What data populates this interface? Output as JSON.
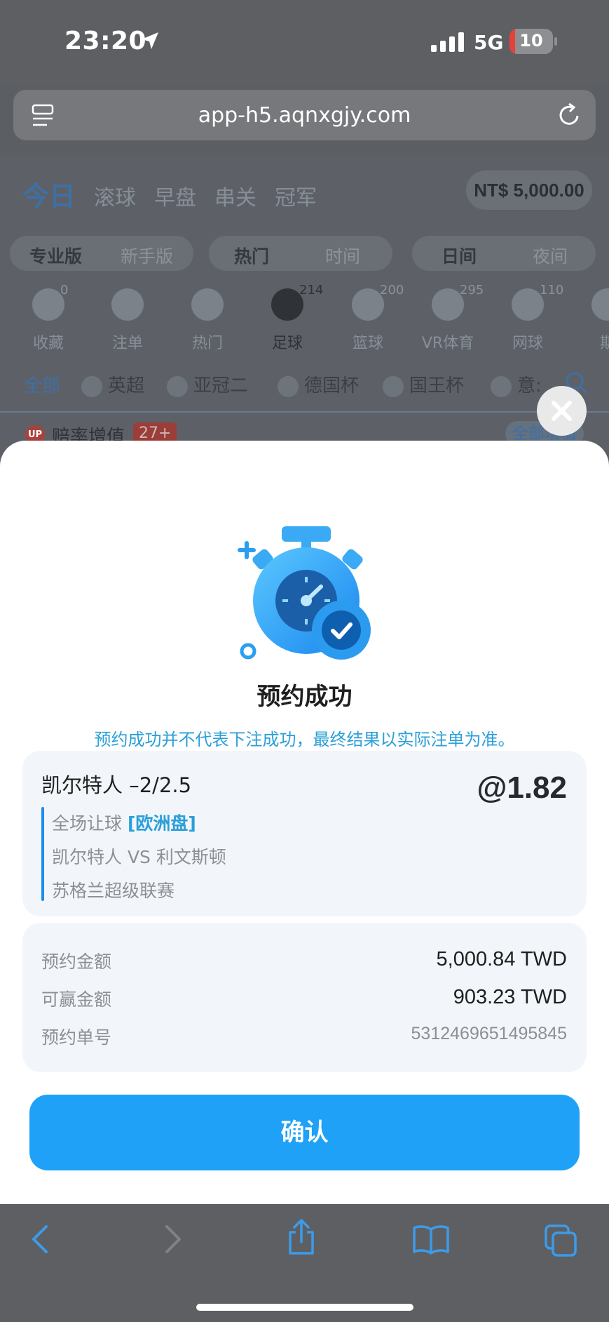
{
  "status_bar": {
    "time": "23:20",
    "network": "5G",
    "battery": "10"
  },
  "browser": {
    "url": "app-h5.aqnxgjy.com"
  },
  "background": {
    "tabs": [
      "今日",
      "滚球",
      "早盘",
      "串关",
      "冠军"
    ],
    "balance": "NT$ 5,000.00",
    "modes": [
      "专业版",
      "新手版"
    ],
    "sorts": [
      "热门",
      "时间"
    ],
    "themes": [
      "日间",
      "夜间"
    ],
    "categories": [
      {
        "label": "收藏",
        "count": "0"
      },
      {
        "label": "注单",
        "count": ""
      },
      {
        "label": "热门",
        "count": ""
      },
      {
        "label": "足球",
        "count": "214"
      },
      {
        "label": "篮球",
        "count": "200"
      },
      {
        "label": "VR体育",
        "count": "295"
      },
      {
        "label": "网球",
        "count": "110"
      },
      {
        "label": "斯",
        "count": ""
      }
    ],
    "leagues": [
      "全部",
      "英超",
      "亚冠二",
      "德国杯",
      "国王杯",
      "意:"
    ],
    "odds_boost": {
      "badge": "UP",
      "label": "赔率增值",
      "count": "27+",
      "link": "全部增值"
    }
  },
  "modal": {
    "title": "预约成功",
    "notice": "预约成功并不代表下注成功，最终结果以实际注单为准。",
    "bet": {
      "selection": "凯尔特人 –2/2.5",
      "odds": "@1.82",
      "market": "全场让球",
      "market_type": "[欧洲盘]",
      "match": "凯尔特人 VS 利文斯顿",
      "league": "苏格兰超级联赛"
    },
    "details": [
      {
        "label": "预约金额",
        "value": "5,000.84 TWD"
      },
      {
        "label": "可赢金额",
        "value": "903.23 TWD"
      },
      {
        "label": "预约单号",
        "value": "5312469651495845"
      }
    ],
    "confirm_label": "确认"
  },
  "colors": {
    "accent": "#1ea1f6",
    "link": "#2a9fd8"
  }
}
